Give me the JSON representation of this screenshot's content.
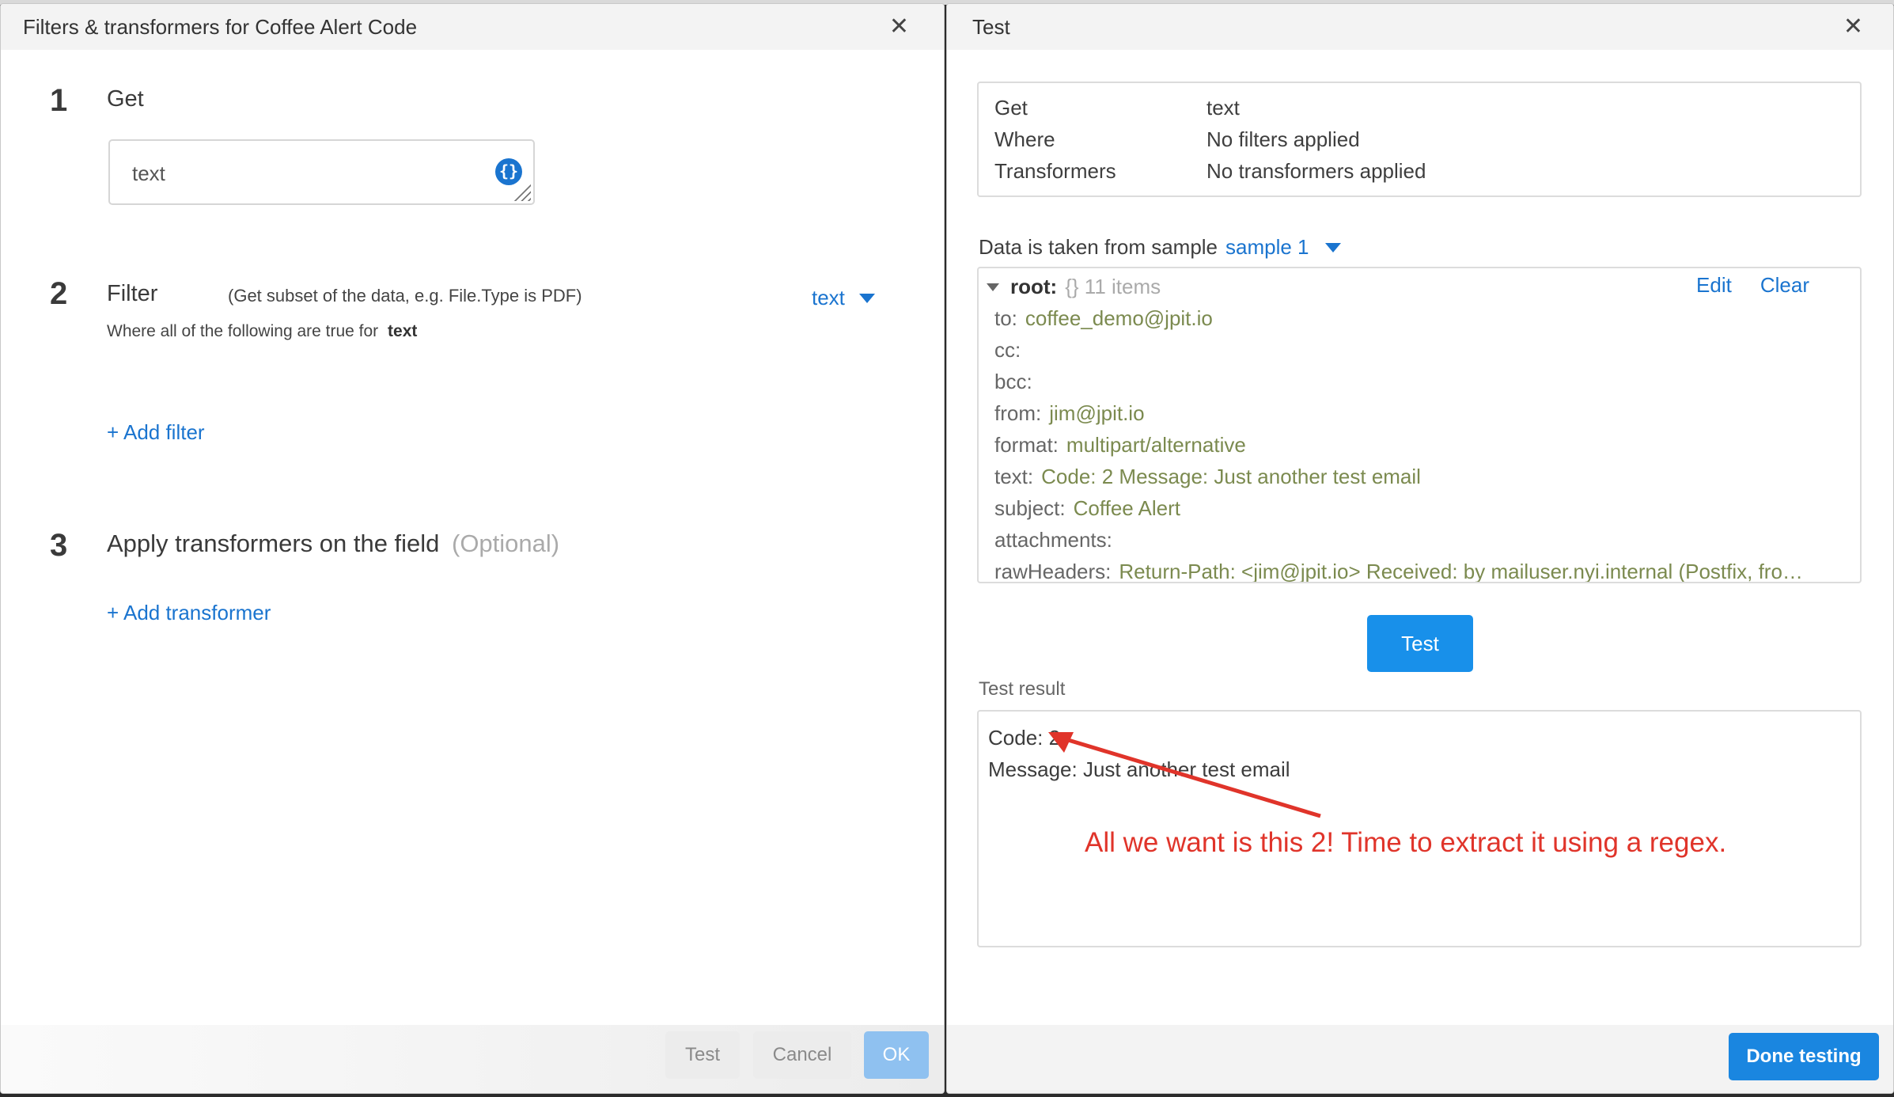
{
  "left_panel": {
    "title": "Filters & transformers for Coffee Alert Code",
    "close_icon": "close-icon",
    "steps": [
      {
        "number": "1",
        "title": "Get",
        "input_value": "text",
        "input_icon": "braces-icon"
      },
      {
        "number": "2",
        "title": "Filter",
        "hint": "(Get subset of the data, e.g. File.Type is PDF)",
        "subtitle_prefix": "Where all of the following are true for",
        "subtitle_field": "text",
        "field_select": "text",
        "add_link": "+ Add filter"
      },
      {
        "number": "3",
        "title": "Apply transformers on the field",
        "optional": "(Optional)",
        "add_link": "+ Add transformer"
      }
    ],
    "footer": {
      "test_label": "Test",
      "cancel_label": "Cancel",
      "ok_label": "OK"
    }
  },
  "right_panel": {
    "title": "Test",
    "close_icon": "close-icon",
    "summary": [
      {
        "key": "Get",
        "value": "text"
      },
      {
        "key": "Where",
        "value": "No filters applied"
      },
      {
        "key": "Transformers",
        "value": "No transformers applied"
      }
    ],
    "sample_prefix": "Data is taken from sample",
    "sample_selected": "sample 1",
    "tree": {
      "root_key": "root:",
      "root_meta": "{} 11 items",
      "edit_label": "Edit",
      "clear_label": "Clear",
      "rows": [
        {
          "key": "to:",
          "value": "coffee_demo@jpit.io"
        },
        {
          "key": "cc:",
          "value": ""
        },
        {
          "key": "bcc:",
          "value": ""
        },
        {
          "key": "from:",
          "value": "jim@jpit.io"
        },
        {
          "key": "format:",
          "value": "multipart/alternative"
        },
        {
          "key": "text:",
          "value": "Code: 2 Message: Just another test email"
        },
        {
          "key": "subject:",
          "value": "Coffee Alert"
        },
        {
          "key": "attachments:",
          "value": ""
        },
        {
          "key": "rawHeaders:",
          "value": "Return-Path: <jim@jpit.io> Received: by mailuser.nyi.internal (Postfix, fro…"
        }
      ]
    },
    "test_button": "Test",
    "result_label": "Test result",
    "result_lines": [
      "Code: 2",
      "Message: Just another test email"
    ],
    "annotation": "All we want is this 2!  Time to extract it using a regex.",
    "done_label": "Done testing"
  },
  "colors": {
    "accent": "#1a74cf",
    "primary_button": "#1890ea",
    "value_green": "#7b8a4f",
    "annotation_red": "#e0342a"
  }
}
